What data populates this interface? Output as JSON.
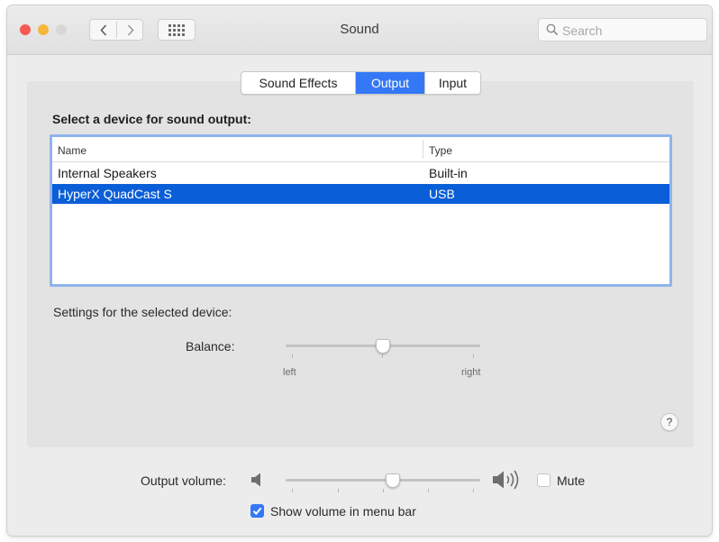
{
  "window": {
    "title": "Sound",
    "search_placeholder": "Search"
  },
  "tabs": [
    {
      "label": "Sound Effects",
      "selected": false
    },
    {
      "label": "Output",
      "selected": true
    },
    {
      "label": "Input",
      "selected": false
    }
  ],
  "output": {
    "heading": "Select a device for sound output:",
    "columns": {
      "name": "Name",
      "type": "Type"
    },
    "devices": [
      {
        "name": "Internal Speakers",
        "type": "Built-in",
        "selected": false
      },
      {
        "name": "HyperX QuadCast S",
        "type": "USB",
        "selected": true
      }
    ],
    "settings_label": "Settings for the selected device:",
    "balance": {
      "label": "Balance:",
      "left_label": "left",
      "right_label": "right",
      "value": 0.5
    }
  },
  "help": {
    "glyph": "?"
  },
  "footer": {
    "output_volume_label": "Output volume:",
    "volume_level": 0.55,
    "mute_label": "Mute",
    "mute_checked": false,
    "show_volume_label": "Show volume in menu bar",
    "show_volume_checked": true
  },
  "colors": {
    "accent": "#3478f6",
    "selection": "#0a5ed7",
    "close": "#f45a52",
    "minimize": "#f6b83a"
  }
}
